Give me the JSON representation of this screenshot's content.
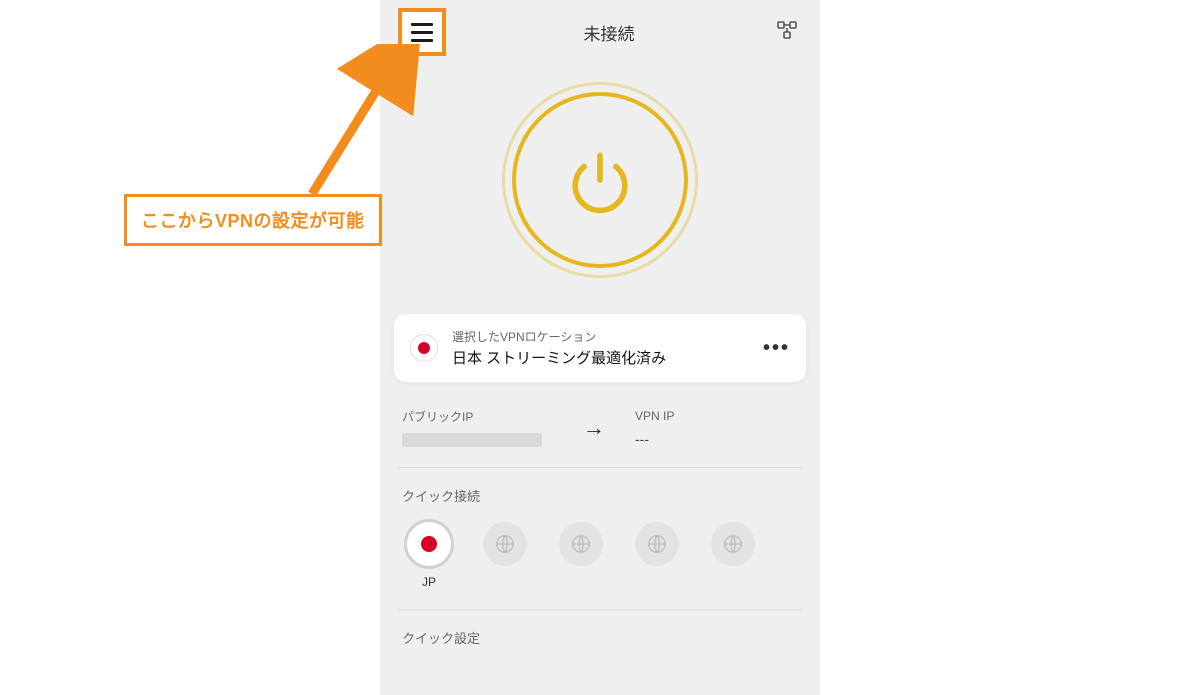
{
  "header": {
    "status": "未接続"
  },
  "location_card": {
    "label": "選択したVPNロケーション",
    "value": "日本 ストリーミング最適化済み"
  },
  "ip": {
    "public_label": "パブリックIP",
    "vpn_label": "VPN IP",
    "vpn_value": "---"
  },
  "quick_connect": {
    "section_label": "クイック接続",
    "items": [
      {
        "label": "JP",
        "type": "flag-jp",
        "selected": true
      },
      {
        "label": "",
        "type": "globe",
        "selected": false
      },
      {
        "label": "",
        "type": "globe",
        "selected": false
      },
      {
        "label": "",
        "type": "globe",
        "selected": false
      },
      {
        "label": "",
        "type": "globe",
        "selected": false
      }
    ]
  },
  "quick_settings": {
    "section_label": "クイック設定"
  },
  "annotation": {
    "text": "ここからVPNの設定が可能"
  },
  "colors": {
    "accent_orange": "#f28c1d",
    "accent_gold": "#e6b61e",
    "flag_red": "#d80027"
  }
}
